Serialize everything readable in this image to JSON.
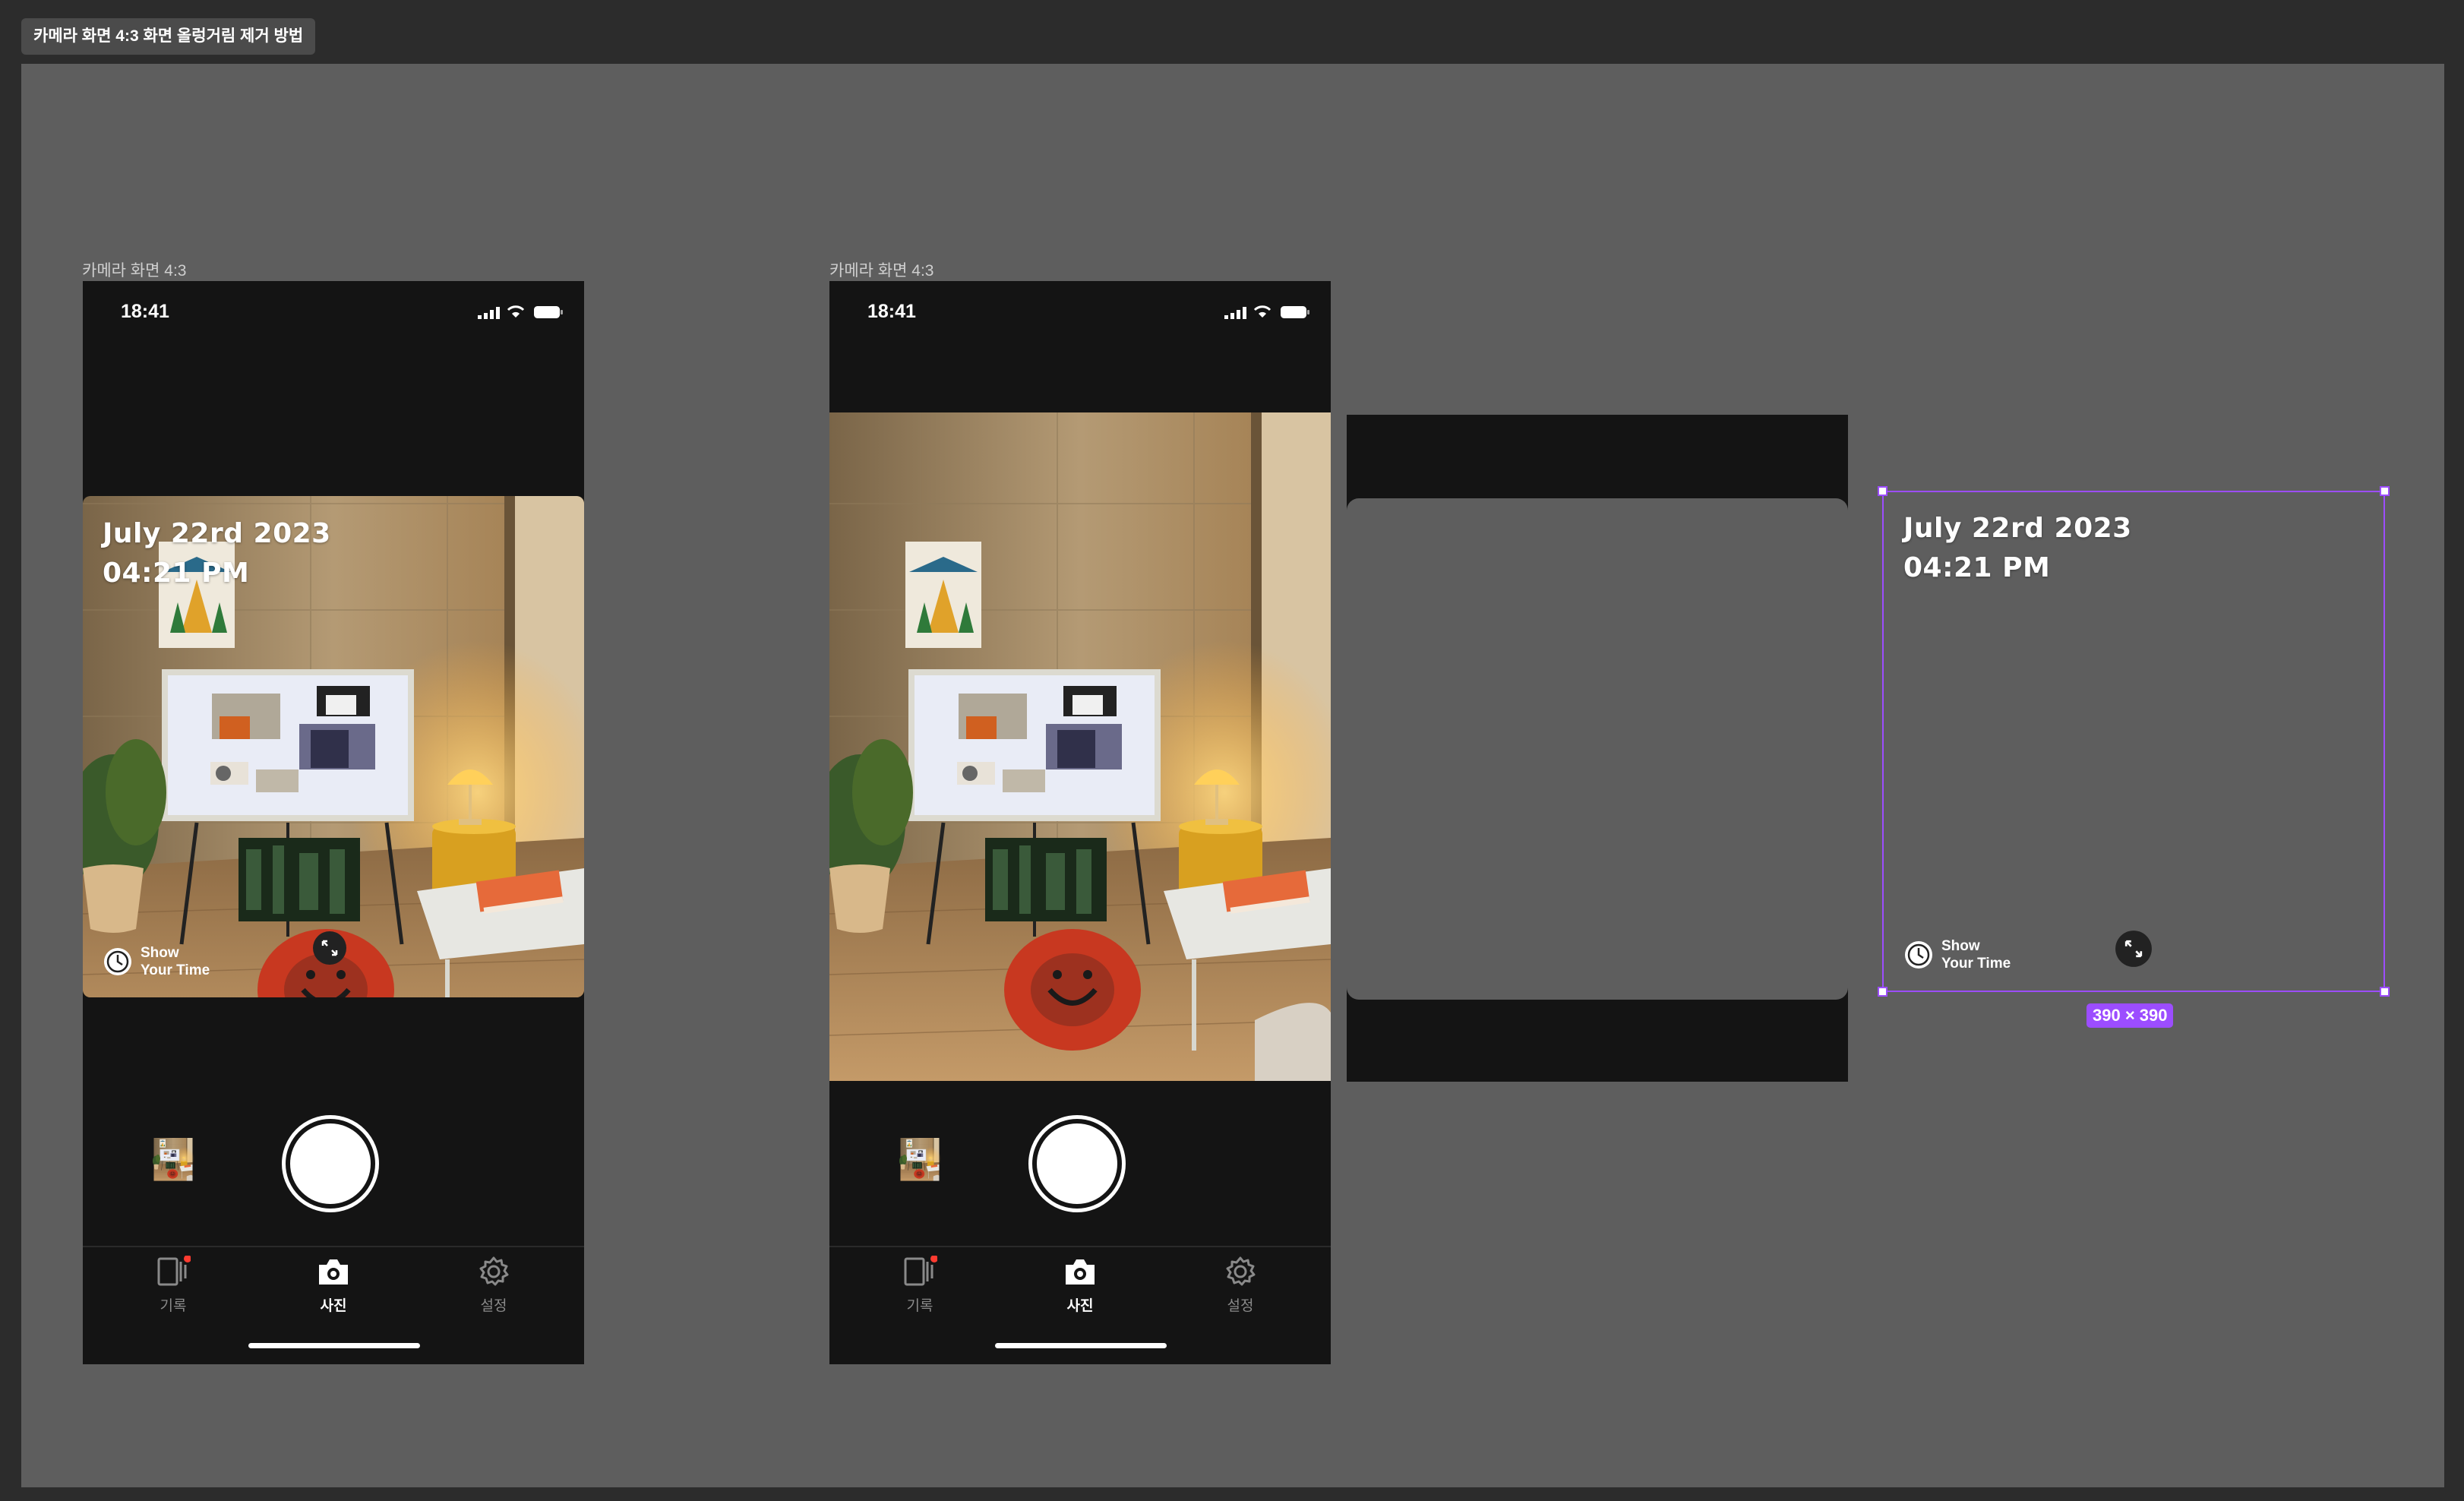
{
  "canvas": {
    "section_title": "카메라 화면 4:3 화면 올렁거림 제거 방법"
  },
  "frames": [
    {
      "label": "카메라 화면 4:3"
    },
    {
      "label": "카메라 화면 4:3"
    }
  ],
  "phone": {
    "status_time": "18:41",
    "overlay_date": "July 22rd 2023",
    "overlay_time": "04:21 PM",
    "logo_line1": "Show",
    "logo_line2": "Your Time",
    "tabs": [
      {
        "label": "기록",
        "icon": "record-icon",
        "active": false,
        "badge": true
      },
      {
        "label": "사진",
        "icon": "camera-icon",
        "active": true,
        "badge": false
      },
      {
        "label": "설정",
        "icon": "gear-icon",
        "active": false,
        "badge": false
      }
    ]
  },
  "overlay_component": {
    "date": "July 22rd 2023",
    "time": "04:21 PM",
    "logo_line1": "Show",
    "logo_line2": "Your Time",
    "dimension_badge": "390 × 390"
  },
  "colors": {
    "selection": "#9c4dff",
    "badge_dot": "#ff3b30",
    "phone_bg": "#141414",
    "canvas_bg": "#5e5e5e"
  }
}
